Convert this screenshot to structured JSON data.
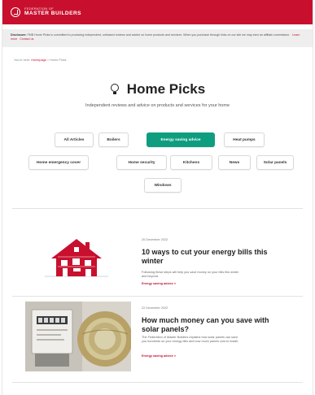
{
  "header": {
    "logo_small": "FEDERATION OF",
    "logo_big": "MASTER BUILDERS"
  },
  "disclosure": {
    "label": "Disclosure:",
    "text": "FMB Home Picks is committed to producing independent, unbiased reviews and advice on home products and services. When you purchase through links on our site we may earn an affiliate commission.",
    "link_1": "Learn more",
    "link_2": "Contact us"
  },
  "breadcrumb": {
    "prefix": "You're here:",
    "home": "Homepage",
    "separator": ">",
    "current": "Home Picks"
  },
  "hero": {
    "title": "Home Picks",
    "subtitle": "Independent reviews and advice on products and services for your home"
  },
  "filters": [
    {
      "label": "All Articles",
      "active": false
    },
    {
      "label": "Boilers",
      "active": false
    },
    {
      "label": "Energy saving advice",
      "active": true
    },
    {
      "label": "Heat pumps",
      "active": false
    },
    {
      "label": "Home emergency cover",
      "active": false
    },
    {
      "label": "Home security",
      "active": false
    },
    {
      "label": "Kitchens",
      "active": false
    },
    {
      "label": "News",
      "active": false
    },
    {
      "label": "Solar panels",
      "active": false
    },
    {
      "label": "Windows",
      "active": false
    }
  ],
  "articles": [
    {
      "date": "20 December 2022",
      "title": "10 ways to cut your energy bills this winter",
      "excerpt": "Following these steps will help you save money on your bills this winter and beyond.",
      "category": "Energy saving advice >"
    },
    {
      "date": "22 December 2022",
      "title": "How much money can you save with solar panels?",
      "excerpt": "The Federation of Master Builders explains how solar panels can save you hundreds on your energy bills and how much panels cost to install.",
      "category": "Energy saving advice >"
    }
  ],
  "colors": {
    "brand_red": "#c8102e",
    "accent_green": "#0f9d80"
  }
}
